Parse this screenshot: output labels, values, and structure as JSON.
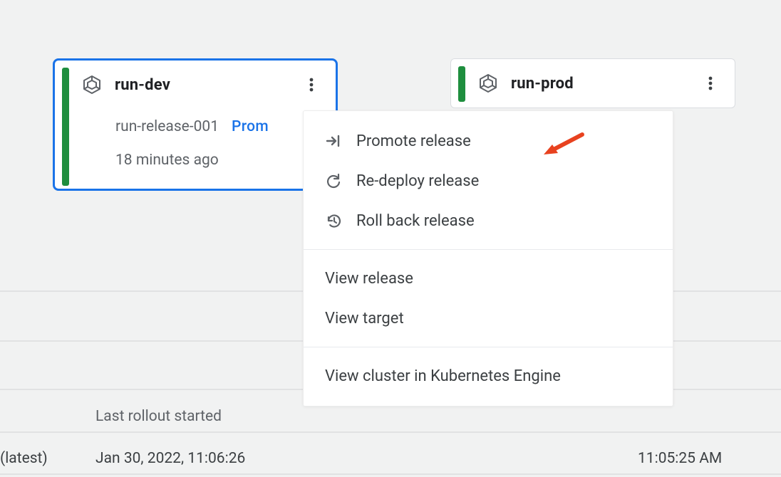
{
  "targets": {
    "dev": {
      "name": "run-dev",
      "release": "run-release-001",
      "promote_label": "Prom",
      "age": "18 minutes ago"
    },
    "prod": {
      "name": "run-prod"
    }
  },
  "menu": {
    "promote": "Promote release",
    "redeploy": "Re-deploy release",
    "rollback": "Roll back release",
    "view_release": "View release",
    "view_target": "View target",
    "view_cluster": "View cluster in Kubernetes Engine"
  },
  "table": {
    "header_last_rollout_started": "Last rollout started",
    "row_latest_tag": "(latest)",
    "row_lro_value": "Jan 30, 2022, 11:06:26",
    "row_time_right": "11:05:25 AM"
  },
  "icons": {
    "gke": "gke-hex-cube",
    "kebab": "more-vert",
    "promote": "arrow-to-bar",
    "redeploy": "refresh-cw",
    "rollback": "history"
  },
  "colors": {
    "accent": "#1a73e8",
    "status_ok": "#1e8e3e",
    "text_primary": "#202124",
    "text_secondary": "#5f6368",
    "arrow_annotation": "#e8421f"
  }
}
